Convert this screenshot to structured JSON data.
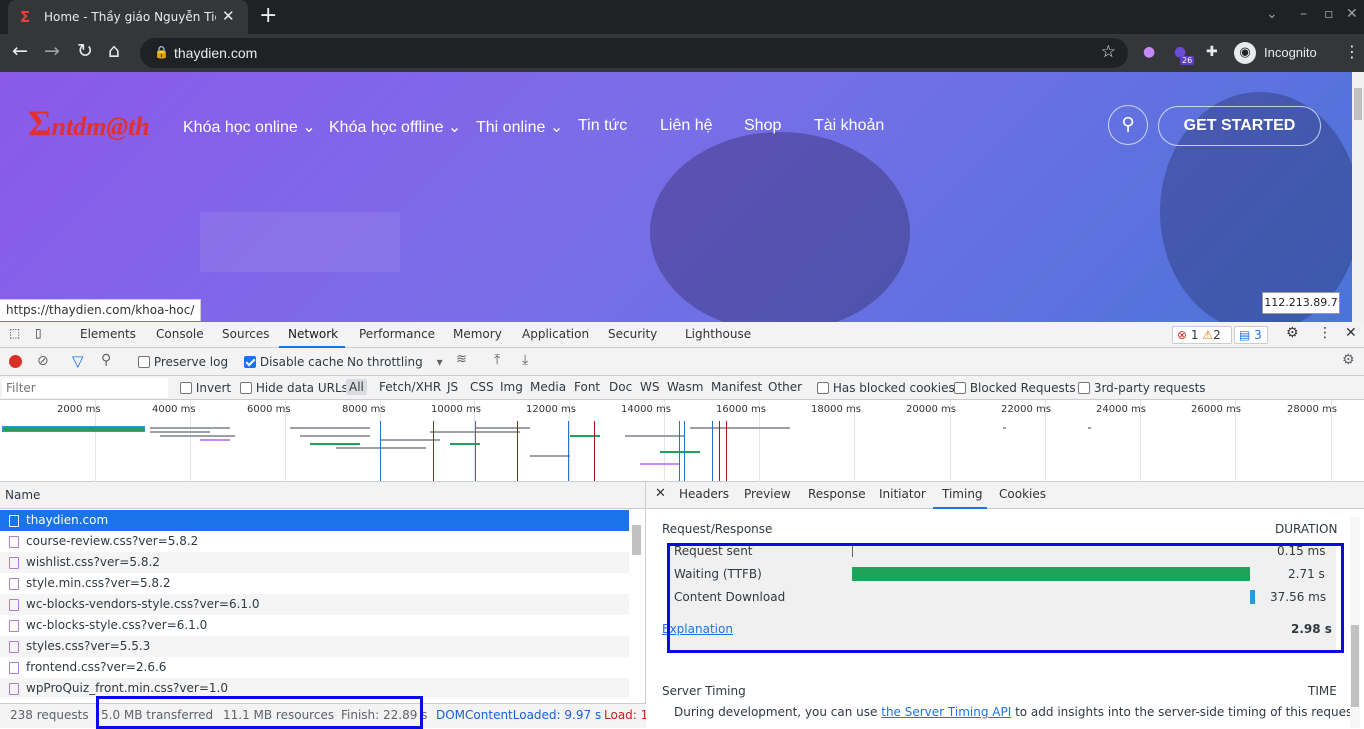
{
  "browser": {
    "tab_title": "Home - Thầy giáo Nguyễn Tiến",
    "tab_icon": "Σ",
    "url": "thaydien.com",
    "extension_badge": "26",
    "incognito_label": "Incognito"
  },
  "site": {
    "logo": "ntdm@th",
    "nav": [
      "Khóa học online",
      "Khóa học offline",
      "Thi online",
      "Tin tức",
      "Liên hệ",
      "Shop",
      "Tài khoản"
    ],
    "cta": "GET STARTED",
    "status_url": "https://thaydien.com/khoa-hoc/",
    "ip": "112.213.89.7"
  },
  "devtools": {
    "tabs": [
      "Elements",
      "Console",
      "Sources",
      "Network",
      "Performance",
      "Memory",
      "Application",
      "Security",
      "Lighthouse"
    ],
    "active_tab": "Network",
    "errors": "1",
    "warnings": "2",
    "messages": "3",
    "controls": {
      "preserve_log": "Preserve log",
      "disable_cache": "Disable cache",
      "throttling": "No throttling"
    },
    "filter": {
      "placeholder": "Filter",
      "invert": "Invert",
      "hide_data_urls": "Hide data URLs",
      "types": [
        "All",
        "Fetch/XHR",
        "JS",
        "CSS",
        "Img",
        "Media",
        "Font",
        "Doc",
        "WS",
        "Wasm",
        "Manifest",
        "Other"
      ],
      "has_blocked_cookies": "Has blocked cookies",
      "blocked_requests": "Blocked Requests",
      "third_party": "3rd-party requests"
    },
    "overview_ticks": [
      "2000 ms",
      "4000 ms",
      "6000 ms",
      "8000 ms",
      "10000 ms",
      "12000 ms",
      "14000 ms",
      "16000 ms",
      "18000 ms",
      "20000 ms",
      "22000 ms",
      "24000 ms",
      "26000 ms",
      "28000 ms"
    ],
    "requests_header": "Name",
    "requests": [
      "thaydien.com",
      "course-review.css?ver=5.8.2",
      "wishlist.css?ver=5.8.2",
      "style.min.css?ver=5.8.2",
      "wc-blocks-vendors-style.css?ver=6.1.0",
      "wc-blocks-style.css?ver=6.1.0",
      "styles.css?ver=5.5.3",
      "frontend.css?ver=2.6.6",
      "wpProQuiz_front.min.css?ver=1.0"
    ],
    "status": {
      "requests": "238 requests",
      "transferred": "5.0 MB transferred",
      "resources": "11.1 MB resources",
      "finish": "Finish: 22.89 s",
      "dcl": "DOMContentLoaded: 9.97 s",
      "load": "Load: 1"
    },
    "detail_tabs": [
      "Headers",
      "Preview",
      "Response",
      "Initiator",
      "Timing",
      "Cookies"
    ],
    "active_detail_tab": "Timing",
    "timing": {
      "section": "Request/Response",
      "duration_header": "DURATION",
      "rows": [
        {
          "label": "Request sent",
          "value": "0.15 ms"
        },
        {
          "label": "Waiting (TTFB)",
          "value": "2.71 s"
        },
        {
          "label": "Content Download",
          "value": "37.56 ms"
        }
      ],
      "explanation": "Explanation",
      "total": "2.98 s",
      "server_timing": "Server Timing",
      "time_header": "TIME",
      "server_note_pre": "During development, you can use ",
      "server_note_link": "the Server Timing API",
      "server_note_post": " to add insights into the server-side timing of this request."
    }
  },
  "colors": {
    "accent": "#1a73e8",
    "ttfb": "#1fa35a",
    "download": "#2a9bd8",
    "highlight": "#0a0ae6"
  }
}
